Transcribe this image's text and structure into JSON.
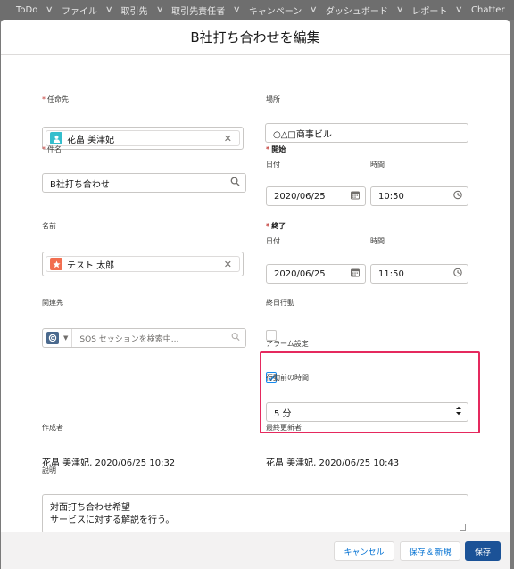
{
  "nav": {
    "items": [
      "ToDo",
      "ファイル",
      "取引先",
      "取引先責任者",
      "キャンペーン",
      "ダッシュボード",
      "レポート",
      "Chatter"
    ]
  },
  "modal": {
    "title": "B社打ち合わせを編集"
  },
  "form": {
    "assignee_label": "任命先",
    "assignee_value": "花畠 美津妃",
    "location_label": "場所",
    "location_value": "○△□商事ビル",
    "subject_label": "件名",
    "subject_value": "B社打ち合わせ",
    "start_label": "開始",
    "start_date_label": "日付",
    "start_date": "2020/06/25",
    "start_time_label": "時間",
    "start_time": "10:50",
    "name_label": "名前",
    "name_value": "テスト 太郎",
    "end_label": "終了",
    "end_date_label": "日付",
    "end_date": "2020/06/25",
    "end_time_label": "時間",
    "end_time": "11:50",
    "related_label": "関連先",
    "related_placeholder": "SOS セッションを検索中...",
    "allday_label": "終日行動",
    "alarm_label": "アラーム設定",
    "alarm_before_label": "行動前の時間",
    "alarm_before_value": "5 分",
    "created_by_label": "作成者",
    "created_by_value": "花畠 美津妃, 2020/06/25 10:32",
    "modified_by_label": "最終更新者",
    "modified_by_value": "花畠 美津妃, 2020/06/25 10:43",
    "description_label": "説明",
    "description_line1": "対面打ち合わせ希望",
    "description_line2": "サービスに対する解説を行う。",
    "required_mark": "*"
  },
  "footer": {
    "cancel_label": "キャンセル",
    "save_new_label": "保存 & 新規",
    "save_label": "保存"
  },
  "colors": {
    "brand": "#1b5297",
    "highlight": "#e5295e",
    "user_icon": "#34becd",
    "contact_icon": "#f26e50",
    "related_icon": "#4a698d"
  }
}
